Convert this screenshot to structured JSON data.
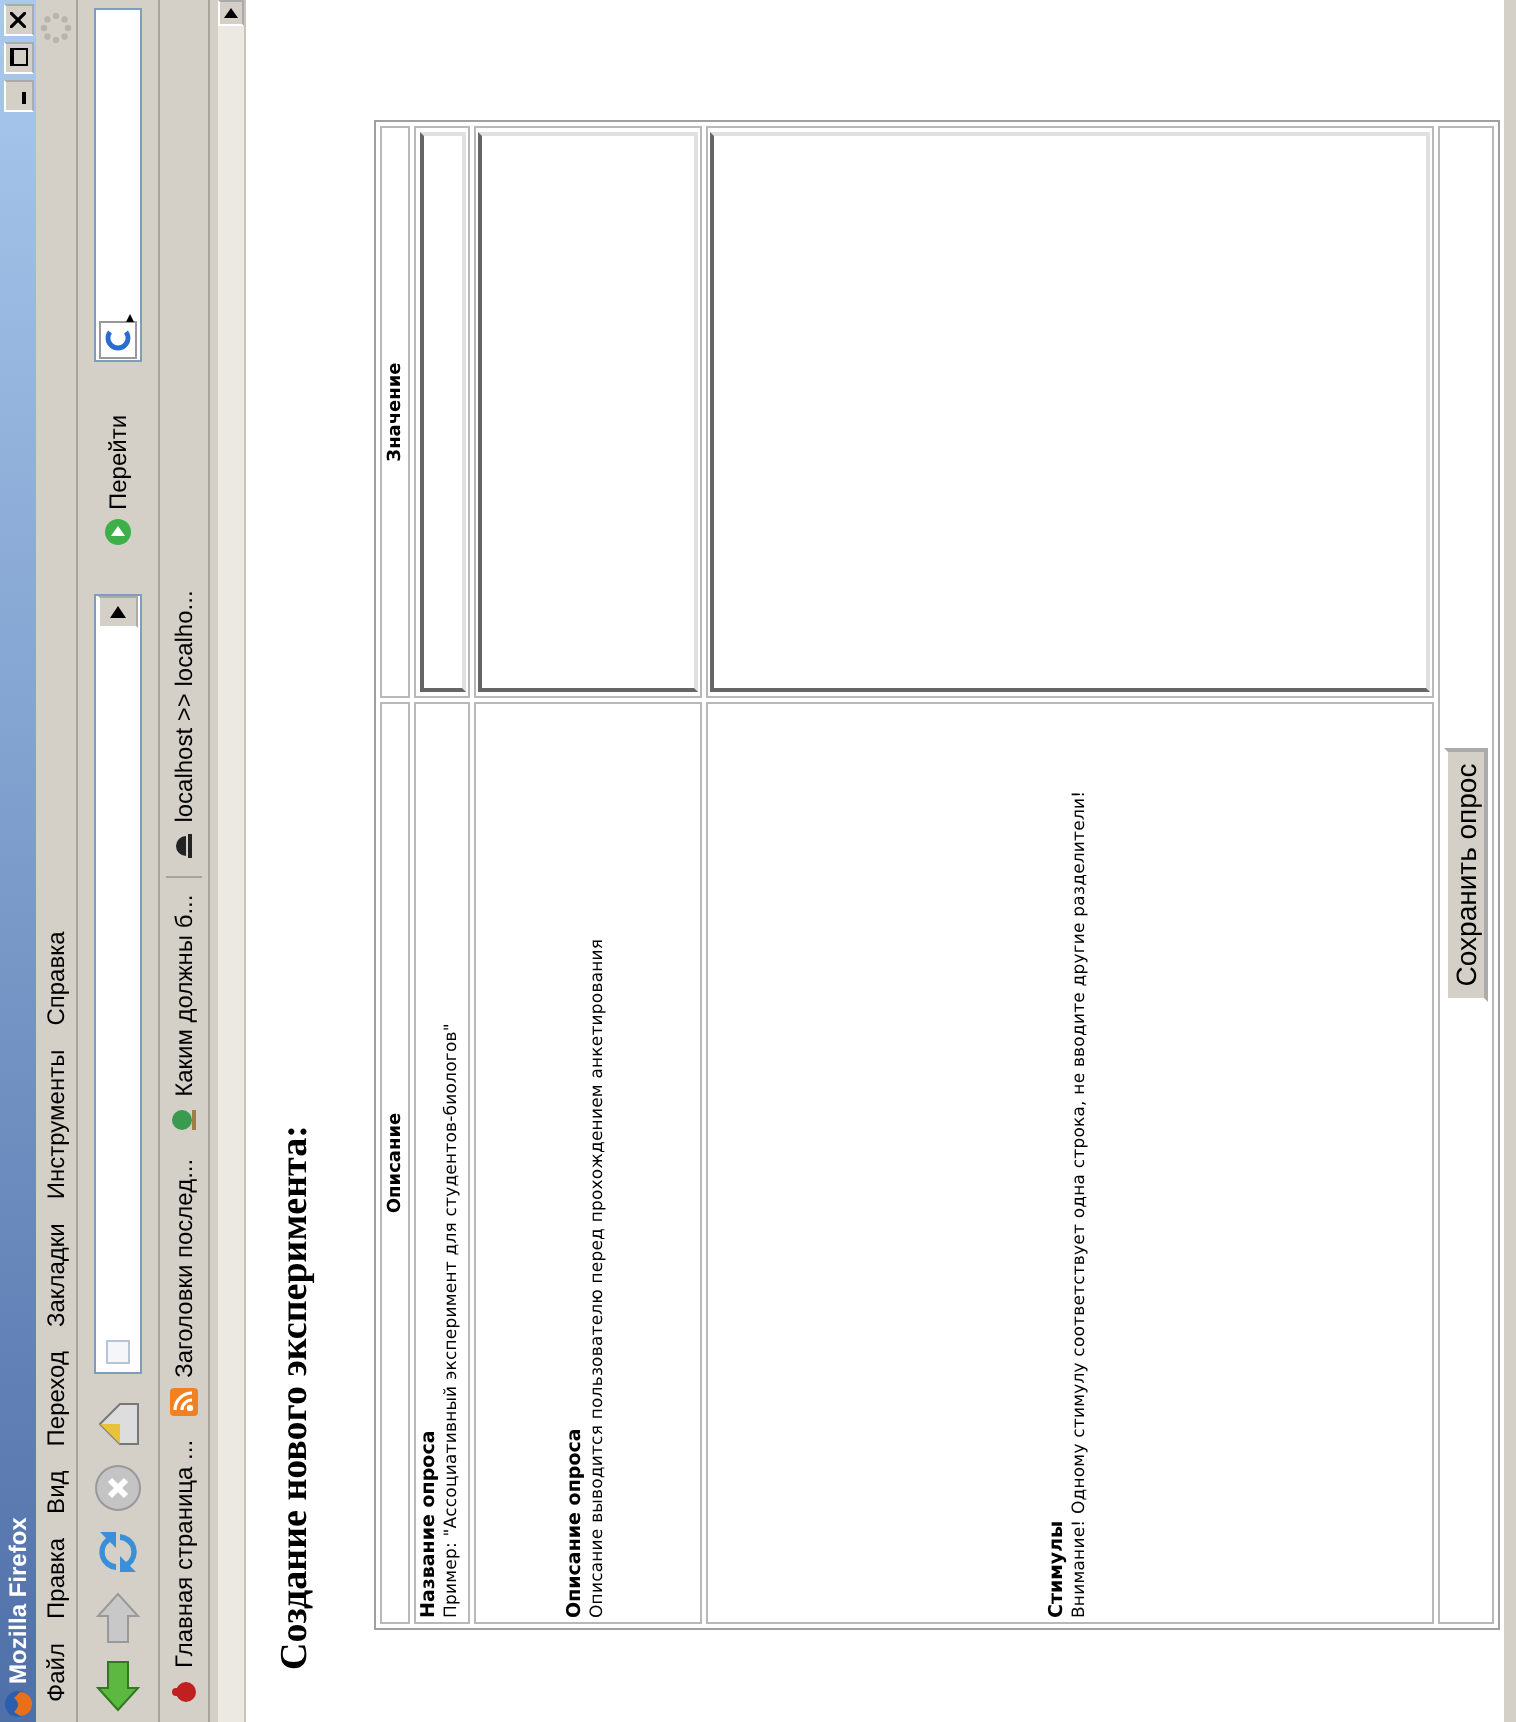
{
  "window": {
    "title": "Mozilla Firefox"
  },
  "menu": [
    "Файл",
    "Правка",
    "Вид",
    "Переход",
    "Закладки",
    "Инструменты",
    "Справка"
  ],
  "toolbar": {
    "go_label": "Перейти"
  },
  "bookmarks": [
    "Главная страница ...",
    "Заголовки послед...",
    "Каким должны б...",
    "localhost >> localho..."
  ],
  "page": {
    "heading": "Создание нового эксперимента:",
    "columns": [
      "Описание",
      "Значение"
    ],
    "rows": [
      {
        "kind": "input",
        "label": "Название опроса",
        "hint": "Пример: \"Ассоциативный эксперимент для студентов-биологов\""
      },
      {
        "kind": "memo",
        "label": "Описание опроса",
        "hint": "Описание выводится пользователю перед прохождением анкетирования"
      },
      {
        "kind": "list",
        "label": "Стимулы",
        "hint": "Внимание! Одному стимулу соответствует одна строка, не вводите другие разделители!"
      }
    ],
    "submit": "Сохранить опрос"
  }
}
